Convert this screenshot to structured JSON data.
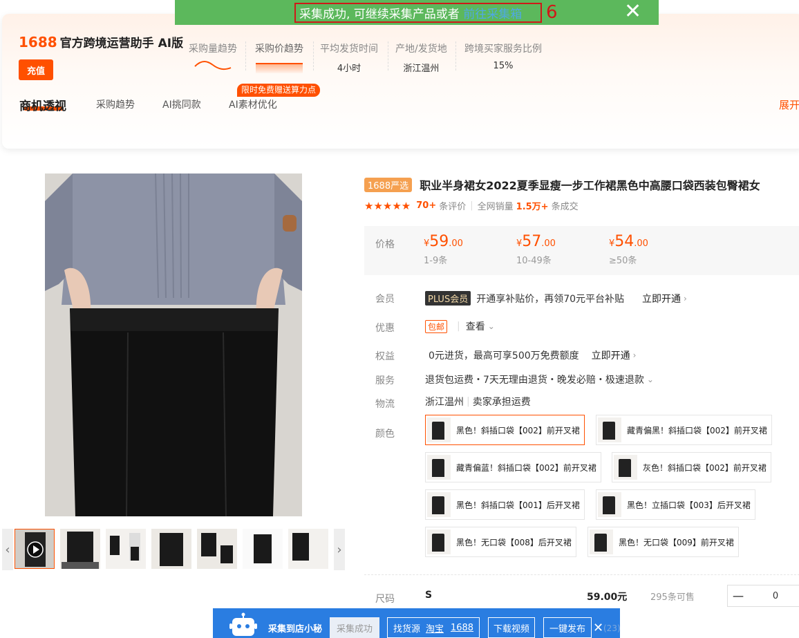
{
  "banner": {
    "message": "采集成功, 可继续采集产品或者",
    "link": "前往采集箱",
    "number": "6",
    "close": "✕"
  },
  "assistant": {
    "brand_1688": "1688",
    "brand_text": "官方跨境运营助手 AI版",
    "recharge": "充值",
    "metrics": [
      {
        "label": "采购量趋势",
        "value": ""
      },
      {
        "label": "采购价趋势",
        "value": ""
      },
      {
        "label": "平均发货时间",
        "value": "4小时"
      },
      {
        "label": "产地/发货地",
        "value": "浙江温州"
      },
      {
        "label": "跨境买家服务比例",
        "value": "15%"
      }
    ],
    "tabs": [
      "商机透视",
      "采购趋势",
      "AI挑同款",
      "AI素材优化"
    ],
    "promo": "限时免费赠送算力点",
    "expand": "展开"
  },
  "product": {
    "tag": "1688严选",
    "title": "职业半身裙女2022夏季显瘦一步工作裙黑色中高腰口袋西装包臀裙女",
    "rating_count": "70+",
    "rating_suffix": "条评价",
    "sales_prefix": "全网销量",
    "sales_value": "1.5万+",
    "sales_suffix": "条成交",
    "price_label": "价格",
    "tiers": [
      {
        "currency": "¥",
        "int": "59",
        "dec": ".00",
        "qty": "1-9条"
      },
      {
        "currency": "¥",
        "int": "57",
        "dec": ".00",
        "qty": "10-49条"
      },
      {
        "currency": "¥",
        "int": "54",
        "dec": ".00",
        "qty": "≥50条"
      }
    ],
    "member_label": "会员",
    "plus_badge": "PLUS会员",
    "member_text": "开通享补贴价，再领70元平台补贴",
    "member_link": "立即开通",
    "discount_label": "优惠",
    "discount_tag": "包邮",
    "discount_link": "查看",
    "rights_label": "权益",
    "rights_text": "0元进货，最高可享500万免费额度",
    "rights_link": "立即开通",
    "service_label": "服务",
    "service_text": "退货包运费・7天无理由退货・晚发必赔・极速退款",
    "logistics_label": "物流",
    "logistics_origin": "浙江温州",
    "logistics_fee": "卖家承担运费",
    "color_label": "颜色",
    "colors": [
      "黑色！斜插口袋【002】前开叉裙",
      "藏青偏黑！斜插口袋【002】前开叉裙",
      "藏青偏蓝！斜插口袋【002】前开叉裙",
      "灰色！斜插口袋【002】前开叉裙",
      "黑色！斜插口袋【001】后开叉裙",
      "黑色！立插口袋【003】后开叉裙",
      "黑色！无口袋【008】后开叉裙",
      "黑色！无口袋【009】前开叉裙"
    ],
    "size_label": "尺码",
    "size_value": "S",
    "size_price": "59.00元",
    "size_stock": "295条可售",
    "qty": "0",
    "minus": "一"
  },
  "toolbar": {
    "title": "采集到店小秘",
    "collected": "采集成功",
    "find_source": "找货源",
    "taobao": "淘宝",
    "s1688": "1688",
    "download_video": "下载视频",
    "publish": "一键发布",
    "close": "✕",
    "count": "(23)"
  }
}
